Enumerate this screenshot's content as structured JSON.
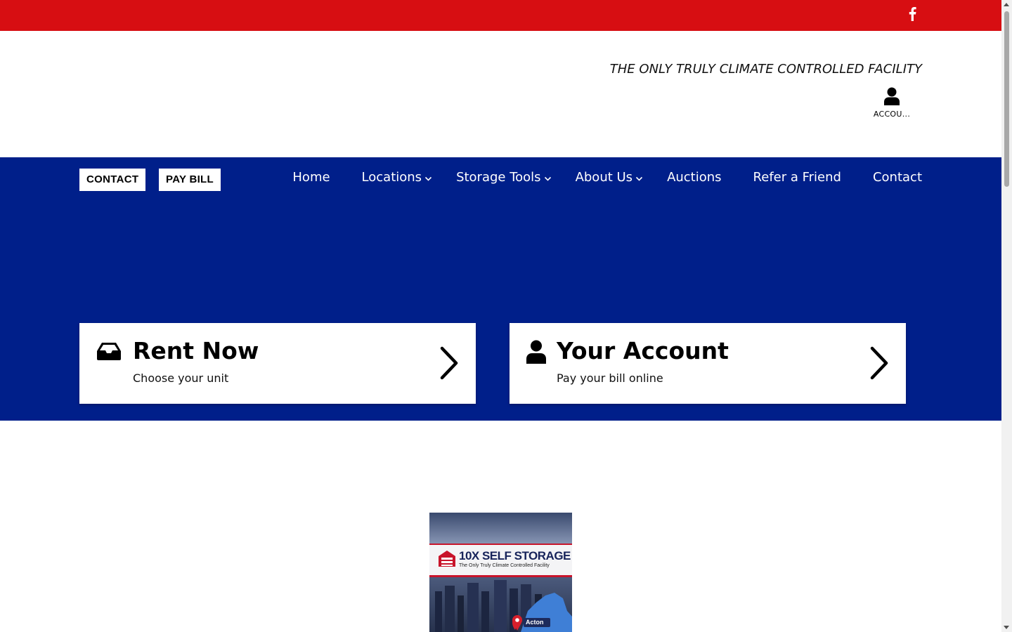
{
  "social": {
    "facebook_icon": "facebook-icon"
  },
  "header": {
    "tagline": "THE ONLY TRULY CLIMATE CONTROLLED FACILITY",
    "account_label": "ACCOU..."
  },
  "quick_buttons": {
    "contact": "CONTACT",
    "pay_bill": "PAY BILL"
  },
  "nav": {
    "items": [
      {
        "label": "Home"
      },
      {
        "label": "Locations"
      },
      {
        "label": "Storage Tools"
      },
      {
        "label": "About Us"
      },
      {
        "label": "Auctions"
      },
      {
        "label": "Refer a Friend"
      },
      {
        "label": "Contact"
      }
    ]
  },
  "cards": {
    "rent": {
      "title": "Rent Now",
      "subtitle": "Choose your unit",
      "icon": "inbox-icon"
    },
    "account": {
      "title": "Your Account",
      "subtitle": "Pay your bill online",
      "icon": "user-icon"
    }
  },
  "promo": {
    "brand": "10X SELF STORAGE",
    "tagline": "The Only Truly Climate Controlled Facility",
    "map_pin_label": "Acton"
  },
  "colors": {
    "topbar": "#d70e12",
    "hero": "#001f8a"
  }
}
